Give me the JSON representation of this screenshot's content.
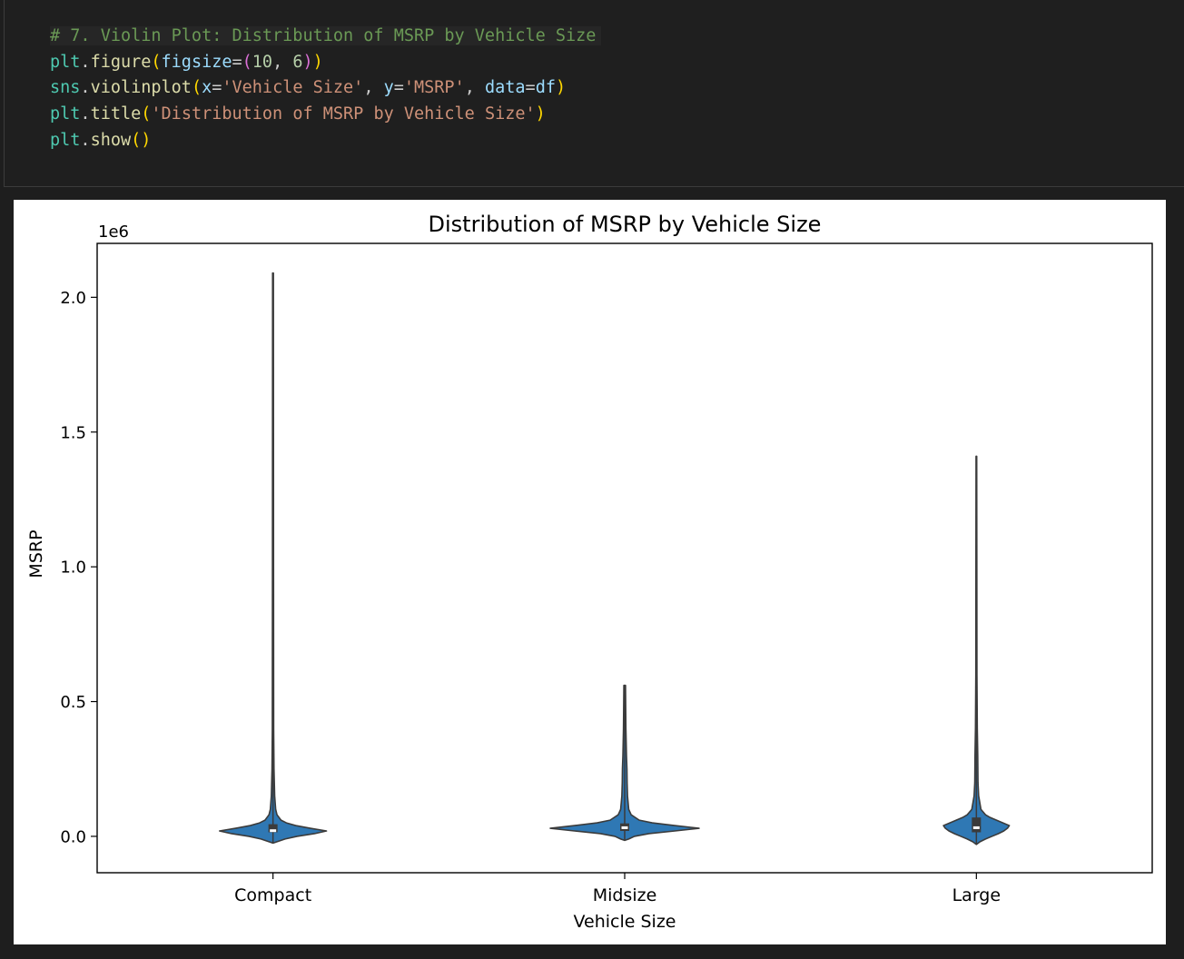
{
  "code_cell": {
    "lines": [
      [
        {
          "t": "# 7. Violin Plot: Distribution of MSRP by Vehicle Size",
          "c": "c-comment"
        }
      ],
      [
        {
          "t": "plt",
          "c": "c-var"
        },
        {
          "t": ".",
          "c": "c-plain"
        },
        {
          "t": "figure",
          "c": "c-fn"
        },
        {
          "t": "(",
          "c": "c-b1"
        },
        {
          "t": "figsize",
          "c": "c-param"
        },
        {
          "t": "=",
          "c": "c-plain"
        },
        {
          "t": "(",
          "c": "c-b2"
        },
        {
          "t": "10",
          "c": "c-num"
        },
        {
          "t": ", ",
          "c": "c-plain"
        },
        {
          "t": "6",
          "c": "c-num"
        },
        {
          "t": ")",
          "c": "c-b2"
        },
        {
          "t": ")",
          "c": "c-b1"
        }
      ],
      [
        {
          "t": "sns",
          "c": "c-var"
        },
        {
          "t": ".",
          "c": "c-plain"
        },
        {
          "t": "violinplot",
          "c": "c-fn"
        },
        {
          "t": "(",
          "c": "c-b1"
        },
        {
          "t": "x",
          "c": "c-param"
        },
        {
          "t": "=",
          "c": "c-plain"
        },
        {
          "t": "'Vehicle Size'",
          "c": "c-str"
        },
        {
          "t": ", ",
          "c": "c-plain"
        },
        {
          "t": "y",
          "c": "c-param"
        },
        {
          "t": "=",
          "c": "c-plain"
        },
        {
          "t": "'MSRP'",
          "c": "c-str"
        },
        {
          "t": ", ",
          "c": "c-plain"
        },
        {
          "t": "data",
          "c": "c-param"
        },
        {
          "t": "=",
          "c": "c-plain"
        },
        {
          "t": "df",
          "c": "c-param"
        },
        {
          "t": ")",
          "c": "c-b1"
        }
      ],
      [
        {
          "t": "plt",
          "c": "c-var"
        },
        {
          "t": ".",
          "c": "c-plain"
        },
        {
          "t": "title",
          "c": "c-fn"
        },
        {
          "t": "(",
          "c": "c-b1"
        },
        {
          "t": "'Distribution of MSRP by Vehicle Size'",
          "c": "c-str"
        },
        {
          "t": ")",
          "c": "c-b1"
        }
      ],
      [
        {
          "t": "plt",
          "c": "c-var"
        },
        {
          "t": ".",
          "c": "c-plain"
        },
        {
          "t": "show",
          "c": "c-fn"
        },
        {
          "t": "()",
          "c": "c-b1"
        }
      ]
    ]
  },
  "chart_data": {
    "type": "violin",
    "title": "Distribution of MSRP by Vehicle Size",
    "xlabel": "Vehicle Size",
    "ylabel": "MSRP",
    "y_offset_label": "1e6",
    "categories": [
      "Compact",
      "Midsize",
      "Large"
    ],
    "yticks": [
      {
        "v": 0.0,
        "label": "0.0"
      },
      {
        "v": 0.5,
        "label": "0.5"
      },
      {
        "v": 1.0,
        "label": "1.0"
      },
      {
        "v": 1.5,
        "label": "1.5"
      },
      {
        "v": 2.0,
        "label": "2.0"
      }
    ],
    "ylim": [
      -0.135,
      2.2
    ],
    "grid": false,
    "fill_color": "#2f78b4",
    "edge_color": "#3b3b3b",
    "violins": [
      {
        "category": "Compact",
        "profile": [
          [
            -0.025,
            0
          ],
          [
            -0.02,
            0.06
          ],
          [
            -0.01,
            0.18
          ],
          [
            0,
            0.36
          ],
          [
            0.01,
            0.62
          ],
          [
            0.02,
            0.8
          ],
          [
            0.03,
            0.56
          ],
          [
            0.04,
            0.34
          ],
          [
            0.05,
            0.2
          ],
          [
            0.06,
            0.12
          ],
          [
            0.08,
            0.06
          ],
          [
            0.1,
            0.04
          ],
          [
            0.15,
            0.025
          ],
          [
            0.25,
            0.015
          ],
          [
            0.4,
            0.01
          ],
          [
            1.0,
            0.008
          ],
          [
            2.09,
            0.006
          ]
        ],
        "max_half_width": 0.19,
        "median": 0.021,
        "q1": 0.015,
        "q3": 0.045
      },
      {
        "category": "Midsize",
        "profile": [
          [
            -0.015,
            0
          ],
          [
            -0.01,
            0.05
          ],
          [
            0,
            0.12
          ],
          [
            0.01,
            0.3
          ],
          [
            0.02,
            0.62
          ],
          [
            0.03,
            0.92
          ],
          [
            0.04,
            0.62
          ],
          [
            0.05,
            0.34
          ],
          [
            0.06,
            0.18
          ],
          [
            0.08,
            0.08
          ],
          [
            0.1,
            0.05
          ],
          [
            0.15,
            0.035
          ],
          [
            0.2,
            0.03
          ],
          [
            0.25,
            0.028
          ],
          [
            0.3,
            0.022
          ],
          [
            0.4,
            0.015
          ],
          [
            0.56,
            0.01
          ]
        ],
        "max_half_width": 0.23,
        "median": 0.032,
        "q1": 0.02,
        "q3": 0.048
      },
      {
        "category": "Large",
        "profile": [
          [
            -0.03,
            0
          ],
          [
            -0.02,
            0.08
          ],
          [
            -0.01,
            0.2
          ],
          [
            0,
            0.34
          ],
          [
            0.01,
            0.48
          ],
          [
            0.02,
            0.6
          ],
          [
            0.03,
            0.68
          ],
          [
            0.04,
            0.72
          ],
          [
            0.05,
            0.58
          ],
          [
            0.06,
            0.44
          ],
          [
            0.07,
            0.3
          ],
          [
            0.08,
            0.2
          ],
          [
            0.1,
            0.1
          ],
          [
            0.15,
            0.05
          ],
          [
            0.2,
            0.035
          ],
          [
            0.3,
            0.03
          ],
          [
            0.4,
            0.02
          ],
          [
            0.6,
            0.012
          ],
          [
            1.0,
            0.01
          ],
          [
            1.41,
            0.007
          ]
        ],
        "max_half_width": 0.13,
        "median": 0.032,
        "q1": 0.015,
        "q3": 0.07
      }
    ]
  }
}
